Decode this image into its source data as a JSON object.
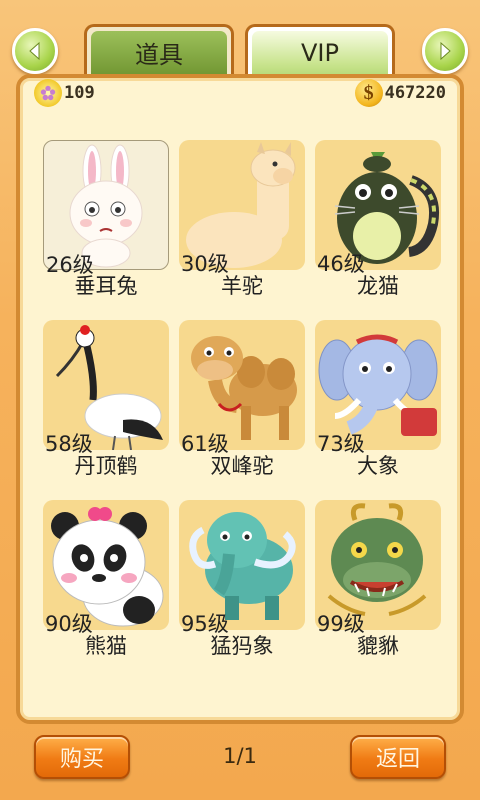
{
  "header": {
    "tabs": [
      {
        "label": "道具",
        "active": false
      },
      {
        "label": "VIP",
        "active": true
      }
    ]
  },
  "stats": {
    "flower_count": "109",
    "coin_count": "467220",
    "coin_symbol": "$"
  },
  "pets": [
    {
      "level": "26级",
      "name": "垂耳兔",
      "icon": "rabbit-icon",
      "selected": true
    },
    {
      "level": "30级",
      "name": "羊驼",
      "icon": "alpaca-icon"
    },
    {
      "level": "46级",
      "name": "龙猫",
      "icon": "totoro-icon"
    },
    {
      "level": "58级",
      "name": "丹顶鹤",
      "icon": "crane-icon"
    },
    {
      "level": "61级",
      "name": "双峰驼",
      "icon": "camel-icon"
    },
    {
      "level": "73级",
      "name": "大象",
      "icon": "elephant-icon"
    },
    {
      "level": "90级",
      "name": "熊猫",
      "icon": "panda-icon"
    },
    {
      "level": "95级",
      "name": "猛犸象",
      "icon": "mammoth-icon"
    },
    {
      "level": "99级",
      "name": "貔貅",
      "icon": "pixiu-icon"
    }
  ],
  "footer": {
    "buy_label": "购买",
    "page": "1/1",
    "back_label": "返回"
  },
  "colors": {
    "accent_orange": "#f07b14",
    "panel_bg": "#fef4d0",
    "card_bg": "#f7d98e",
    "tab_green": "#9cc05a"
  }
}
